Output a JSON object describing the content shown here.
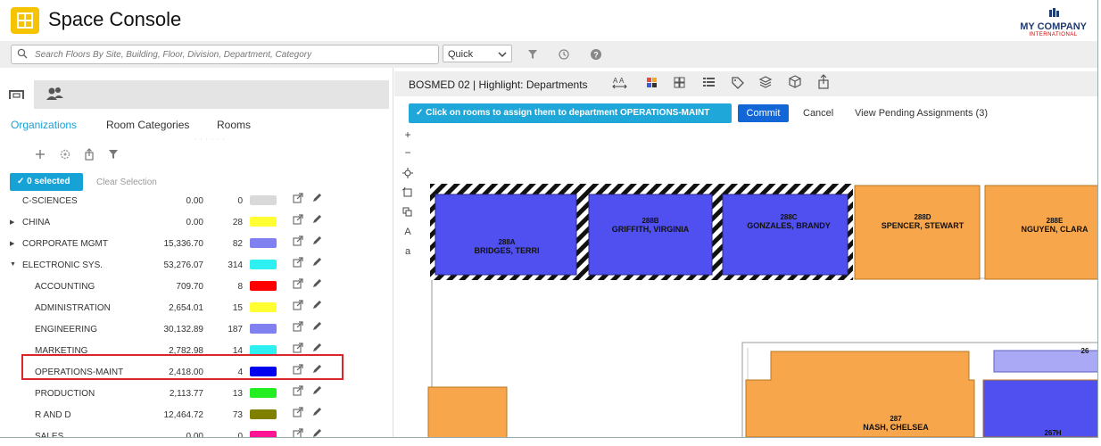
{
  "app": {
    "title": "Space Console",
    "company_name": "MY COMPANY",
    "company_sub": "INTERNATIONAL",
    "brand_color": "#f5c300"
  },
  "search": {
    "placeholder": "Search Floors By Site, Building, Floor, Division, Department, Category",
    "mode": "Quick"
  },
  "left_panel": {
    "subtabs": [
      "Organizations",
      "Room Categories",
      "Rooms"
    ],
    "active_subtab": "Organizations",
    "selected_label": "0 selected",
    "clear_label": "Clear Selection",
    "rows": [
      {
        "name": "C-SCIENCES",
        "area": "0.00",
        "count": "0",
        "color": "#d9d9d9",
        "level": 0,
        "expandable": false
      },
      {
        "name": "CHINA",
        "area": "0.00",
        "count": "28",
        "color": "#ffff33",
        "level": 0,
        "expandable": true
      },
      {
        "name": "CORPORATE MGMT",
        "area": "15,336.70",
        "count": "82",
        "color": "#8080f0",
        "level": 0,
        "expandable": true
      },
      {
        "name": "ELECTRONIC SYS.",
        "area": "53,276.07",
        "count": "314",
        "color": "#2ef0f0",
        "level": 0,
        "expandable": true,
        "expanded": true
      },
      {
        "name": "ACCOUNTING",
        "area": "709.70",
        "count": "8",
        "color": "#ff0000",
        "level": 1
      },
      {
        "name": "ADMINISTRATION",
        "area": "2,654.01",
        "count": "15",
        "color": "#ffff33",
        "level": 1
      },
      {
        "name": "ENGINEERING",
        "area": "30,132.89",
        "count": "187",
        "color": "#8080f0",
        "level": 1
      },
      {
        "name": "MARKETING",
        "area": "2,782.98",
        "count": "14",
        "color": "#2ef0f0",
        "level": 1
      },
      {
        "name": "OPERATIONS-MAINT",
        "area": "2,418.00",
        "count": "4",
        "color": "#0000ee",
        "level": 1
      },
      {
        "name": "PRODUCTION",
        "area": "2,113.77",
        "count": "13",
        "color": "#22ee22",
        "level": 1
      },
      {
        "name": "R AND D",
        "area": "12,464.72",
        "count": "73",
        "color": "#808000",
        "level": 1
      },
      {
        "name": "SALES",
        "area": "0.00",
        "count": "0",
        "color": "#ff1493",
        "level": 1
      }
    ]
  },
  "right_panel": {
    "title": "BOSMED 02 | Highlight: Departments",
    "banner": "Click on rooms to assign them to department OPERATIONS-MAINT",
    "commit": "Commit",
    "cancel": "Cancel",
    "pending": "View Pending Assignments (3)",
    "rooms": [
      {
        "id": "288A",
        "occupant": "BRIDGES, TERRI",
        "color": "#5050f0",
        "hatched": true
      },
      {
        "id": "288B",
        "occupant": "GRIFFITH, VIRGINIA",
        "color": "#5050f0",
        "hatched": true
      },
      {
        "id": "288C",
        "occupant": "GONZALES, BRANDY",
        "color": "#5050f0",
        "hatched": true
      },
      {
        "id": "288D",
        "occupant": "SPENCER, STEWART",
        "color": "#f8a64c"
      },
      {
        "id": "288E",
        "occupant": "NGUYEN, CLARA",
        "color": "#f8a64c"
      },
      {
        "id": "287",
        "occupant": "NASH, CHELSEA",
        "color": "#f8a64c"
      },
      {
        "id": "267H",
        "occupant": "",
        "color": "#5050f0"
      },
      {
        "id": "26",
        "occupant": "",
        "color": "#a9a9f5"
      }
    ]
  }
}
